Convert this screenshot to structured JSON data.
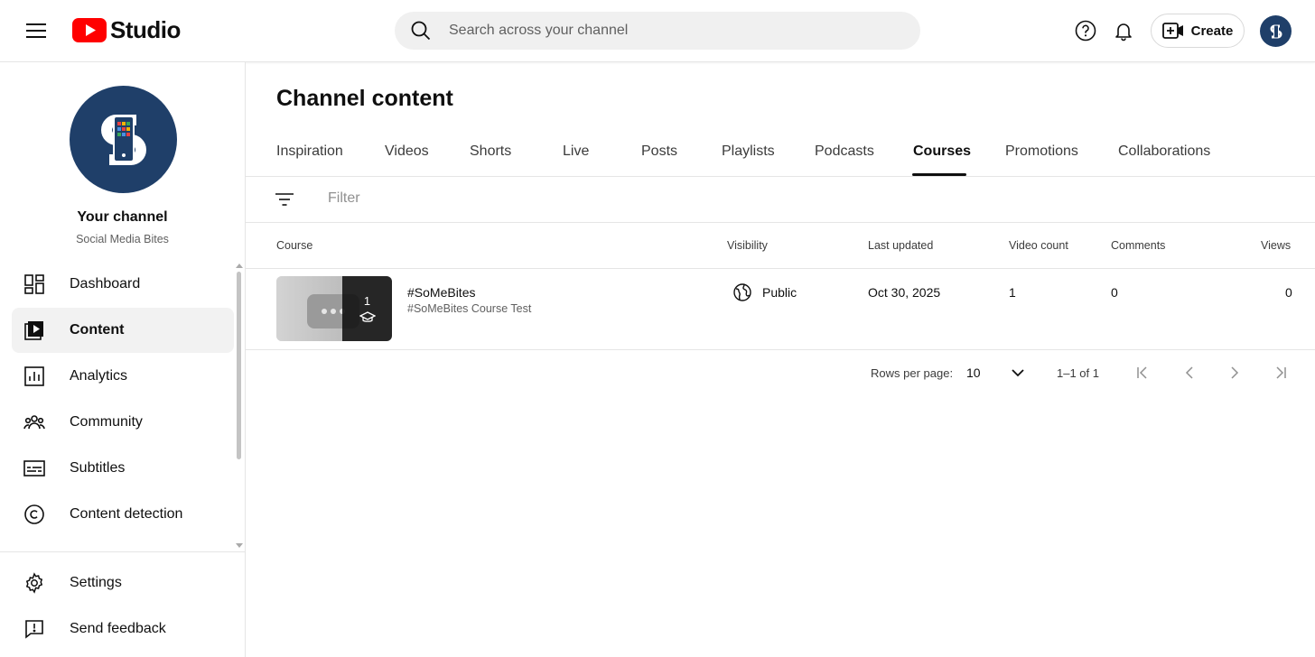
{
  "header": {
    "logo_text": "Studio",
    "search_placeholder": "Search across your channel",
    "create_label": "Create"
  },
  "sidebar": {
    "channel_title": "Your channel",
    "channel_name": "Social Media Bites",
    "items": [
      {
        "label": "Dashboard",
        "icon": "dashboard-icon"
      },
      {
        "label": "Content",
        "icon": "content-icon",
        "active": true
      },
      {
        "label": "Analytics",
        "icon": "analytics-icon"
      },
      {
        "label": "Community",
        "icon": "community-icon"
      },
      {
        "label": "Subtitles",
        "icon": "subtitles-icon"
      },
      {
        "label": "Content detection",
        "icon": "copyright-icon"
      }
    ],
    "bottom_items": [
      {
        "label": "Settings",
        "icon": "gear-icon"
      },
      {
        "label": "Send feedback",
        "icon": "feedback-icon"
      }
    ]
  },
  "main": {
    "title": "Channel content",
    "tabs": [
      "Inspiration",
      "Videos",
      "Shorts",
      "Live",
      "Posts",
      "Playlists",
      "Podcasts",
      "Courses",
      "Promotions",
      "Collaborations"
    ],
    "active_tab": "Courses",
    "filter_placeholder": "Filter",
    "columns": [
      "Course",
      "Visibility",
      "Last updated",
      "Video count",
      "Comments",
      "Views"
    ],
    "rows": [
      {
        "title": "#SoMeBites",
        "description": "#SoMeBites Course Test",
        "thumb_count": "1",
        "visibility": "Public",
        "last_updated": "Oct 30, 2025",
        "video_count": "1",
        "comments": "0",
        "views": "0"
      }
    ],
    "pagination": {
      "rows_per_page_label": "Rows per page:",
      "rows_per_page_value": "10",
      "range": "1–1 of 1"
    }
  },
  "colors": {
    "brand_red": "#ff0000",
    "avatar_bg": "#1f3f69",
    "active_nav_bg": "#f2f2f2"
  }
}
